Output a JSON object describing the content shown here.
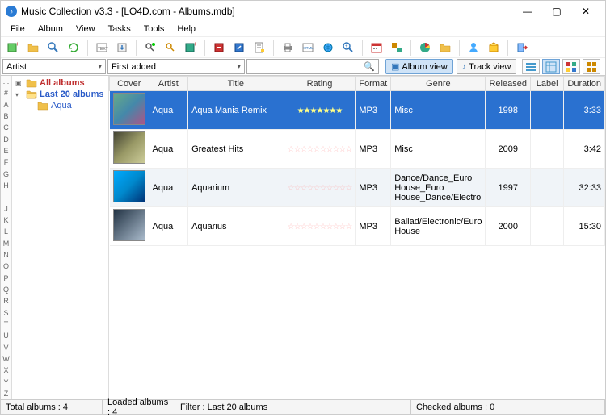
{
  "window": {
    "title": "Music Collection v3.3 - [LO4D.com - Albums.mdb]"
  },
  "menu": [
    "File",
    "Album",
    "View",
    "Tasks",
    "Tools",
    "Help"
  ],
  "filter": {
    "groupBy": "Artist",
    "sortBy": "First added",
    "search": ""
  },
  "viewToggles": {
    "album": "Album view",
    "track": "Track view"
  },
  "alphaIndex": [
    "...",
    "#",
    "A",
    "B",
    "C",
    "D",
    "E",
    "F",
    "G",
    "H",
    "I",
    "J",
    "K",
    "L",
    "M",
    "N",
    "O",
    "P",
    "Q",
    "R",
    "S",
    "T",
    "U",
    "V",
    "W",
    "X",
    "Y",
    "Z"
  ],
  "tree": {
    "root0": "All albums",
    "root1": "Last 20 albums",
    "child0": "Aqua"
  },
  "columns": [
    "Cover",
    "Artist",
    "Title",
    "Rating",
    "Format",
    "Genre",
    "Released",
    "Label",
    "Duration"
  ],
  "rows": [
    {
      "artist": "Aqua",
      "title": "Aqua Mania Remix",
      "rating": 7,
      "format": "MP3",
      "genre": "Misc",
      "released": "1998",
      "label": "",
      "duration": "3:33",
      "selected": true
    },
    {
      "artist": "Aqua",
      "title": "Greatest Hits",
      "rating": 0,
      "format": "MP3",
      "genre": "Misc",
      "released": "2009",
      "label": "",
      "duration": "3:42"
    },
    {
      "artist": "Aqua",
      "title": "Aquarium",
      "rating": 0,
      "format": "MP3",
      "genre": "Dance/Dance_Euro House_Euro House_Dance/Electro",
      "released": "1997",
      "label": "",
      "duration": "32:33",
      "alt": true
    },
    {
      "artist": "Aqua",
      "title": "Aquarius",
      "rating": 0,
      "format": "MP3",
      "genre": "Ballad/Electronic/Euro House",
      "released": "2000",
      "label": "",
      "duration": "15:30"
    }
  ],
  "status": {
    "total": "Total albums : 4",
    "loaded": "Loaded albums : 4",
    "filter": "Filter : Last 20 albums",
    "checked": "Checked albums : 0"
  }
}
